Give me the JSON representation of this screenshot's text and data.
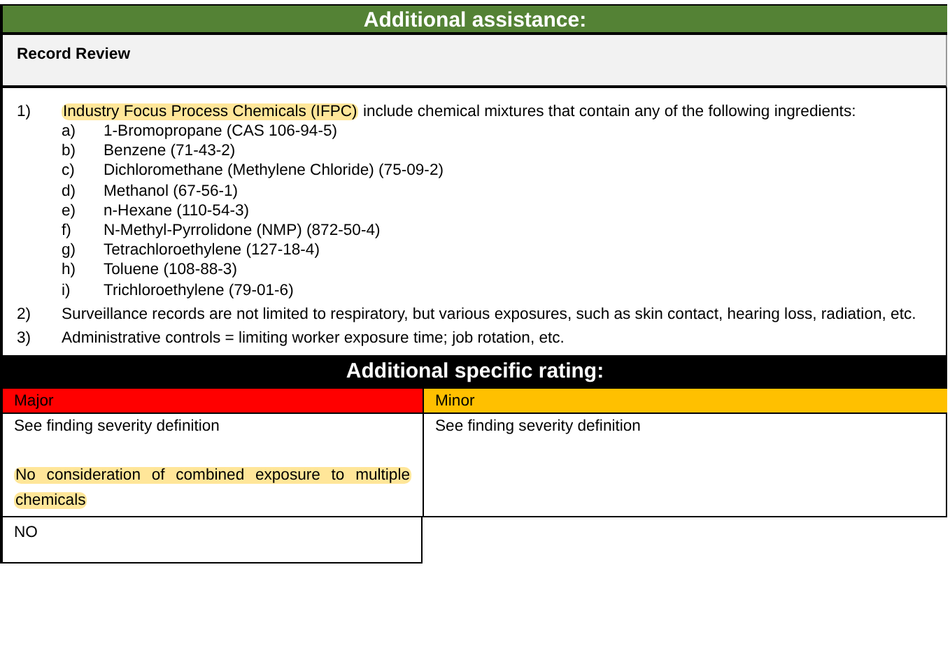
{
  "assistance": {
    "title": "Additional assistance:",
    "subtitle": "Record Review",
    "items": [
      {
        "marker": "1)",
        "highlight": "Industry Focus Process Chemicals (IFPC)",
        "text": " include chemical mixtures that contain any of the following ingredients:",
        "subitems": [
          {
            "marker": "a)",
            "text": "1-Bromopropane (CAS 106-94-5)"
          },
          {
            "marker": "b)",
            "text": "Benzene (71-43-2)"
          },
          {
            "marker": "c)",
            "text": "Dichloromethane (Methylene Chloride) (75-09-2)"
          },
          {
            "marker": "d)",
            "text": "Methanol (67-56-1)"
          },
          {
            "marker": "e)",
            "text": "n-Hexane (110-54-3)"
          },
          {
            "marker": "f)",
            "text": "N-Methyl-Pyrrolidone (NMP) (872-50-4)"
          },
          {
            "marker": "g)",
            "text": "Tetrachloroethylene (127-18-4)"
          },
          {
            "marker": "h)",
            "text": "Toluene (108-88-3)"
          },
          {
            "marker": "i)",
            "text": "Trichloroethylene (79-01-6)"
          }
        ]
      },
      {
        "marker": "2)",
        "text": "Surveillance records are not limited to respiratory, but various exposures, such as skin contact, hearing loss, radiation, etc."
      },
      {
        "marker": "3)",
        "text": "Administrative controls = limiting worker exposure time; job rotation, etc."
      }
    ]
  },
  "rating": {
    "title": "Additional specific rating:",
    "columns": [
      {
        "label": "Major",
        "color": "#ff0000",
        "definition": "See finding severity definition",
        "highlight": "No consideration of combined exposure to multiple chemicals",
        "answer": "NO"
      },
      {
        "label": "Minor",
        "color": "#ffc000",
        "definition": "See finding severity definition"
      }
    ]
  }
}
